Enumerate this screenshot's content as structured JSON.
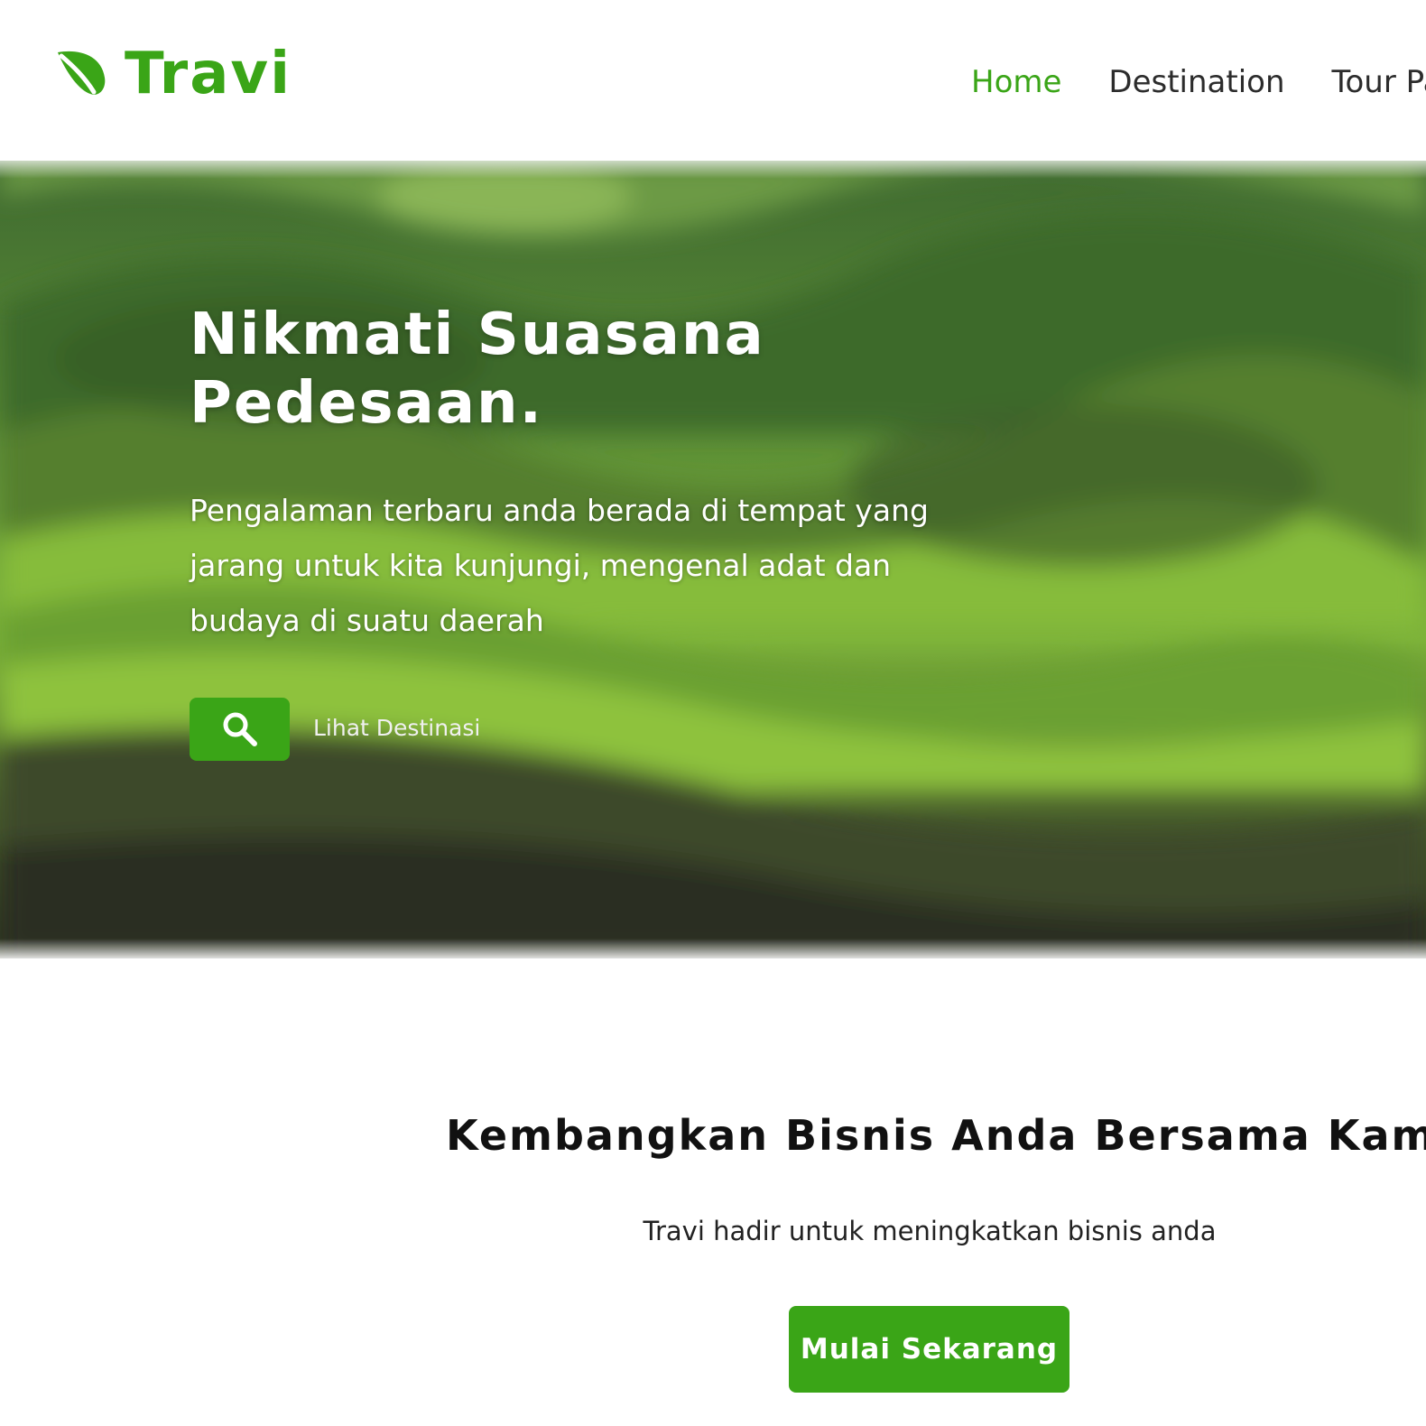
{
  "brand": {
    "name": "Travi",
    "logo_icon": "leaf-icon",
    "color": "#3aa517"
  },
  "nav": {
    "items": [
      {
        "label": "Home",
        "active": true
      },
      {
        "label": "Destination",
        "active": false
      },
      {
        "label": "Tour Pa",
        "active": false
      }
    ]
  },
  "hero": {
    "title": "Nikmati Suasana Pedesaan.",
    "description": "Pengalaman terbaru anda berada di tempat yang jarang untuk kita kunjungi, mengenal adat dan budaya di suatu daerah",
    "search_icon": "search-icon",
    "link_label": "Lihat Destinasi",
    "background": "blurred green hills landscape"
  },
  "business": {
    "title": "Kembangkan Bisnis Anda Bersama Kami",
    "subtitle": "Travi hadir untuk meningkatkan bisnis anda",
    "cta_label": "Mulai Sekarang"
  },
  "colors": {
    "accent": "#3aa517",
    "text_dark": "#111111",
    "nav_text": "#2c2c2c"
  }
}
